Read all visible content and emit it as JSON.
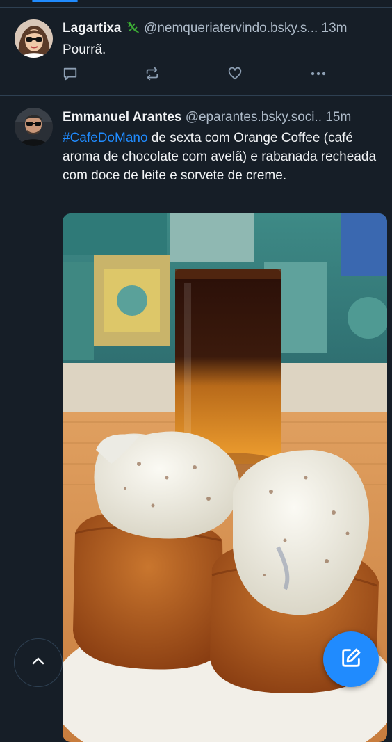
{
  "posts": [
    {
      "author_name": "Lagartixa",
      "author_emoji_icon": "lizard-emoji",
      "handle": "@nemqueriatervindo.bsky.s...",
      "time": "13m",
      "text": "Pourrã."
    },
    {
      "author_name": "Emmanuel Arantes",
      "handle": "@eparantes.bsky.soci..",
      "time": "15m",
      "hashtag": "#CafeDoMano",
      "text": " de sexta com Orange Coffee (café aroma de chocolate com avelã) e rabanada recheada com doce de leite e sorvete de creme.",
      "media": "photo: layered orange coffee drink with rabanada topped with ice cream"
    }
  ],
  "icons": {
    "reply": "reply-icon",
    "repost": "repost-icon",
    "like": "heart-icon",
    "more": "more-icon",
    "scroll_top": "chevron-up-icon",
    "compose": "compose-icon"
  },
  "colors": {
    "background": "#161e27",
    "accent": "#208bfe",
    "text": "#f1f3f5",
    "muted": "#aebbc9",
    "divider": "#2e4052"
  }
}
